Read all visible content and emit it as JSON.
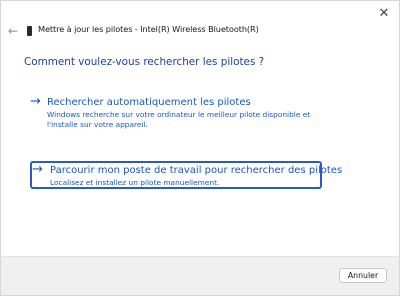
{
  "window": {
    "title": "Mettre à jour les pilotes - Intel(R) Wireless Bluetooth(R)",
    "close_glyph": "✕",
    "back_glyph": "←"
  },
  "main": {
    "heading": "Comment voulez-vous rechercher les pilotes ?",
    "options": [
      {
        "title": "Rechercher automatiquement les pilotes",
        "description": "Windows recherche sur votre ordinateur le meilleur pilote disponible et l'installe sur votre appareil.",
        "arrow_glyph": "→"
      },
      {
        "title": "Parcourir mon poste de travail pour rechercher des pilotes",
        "description": "Localisez et installez un pilote manuellement.",
        "arrow_glyph": "→"
      }
    ]
  },
  "footer": {
    "cancel_label": "Annuler"
  },
  "colors": {
    "link": "#1a56c4",
    "heading": "#1c3e9e",
    "focus_border": "#2a5ac8",
    "footer_bg": "#f0f0f0"
  }
}
